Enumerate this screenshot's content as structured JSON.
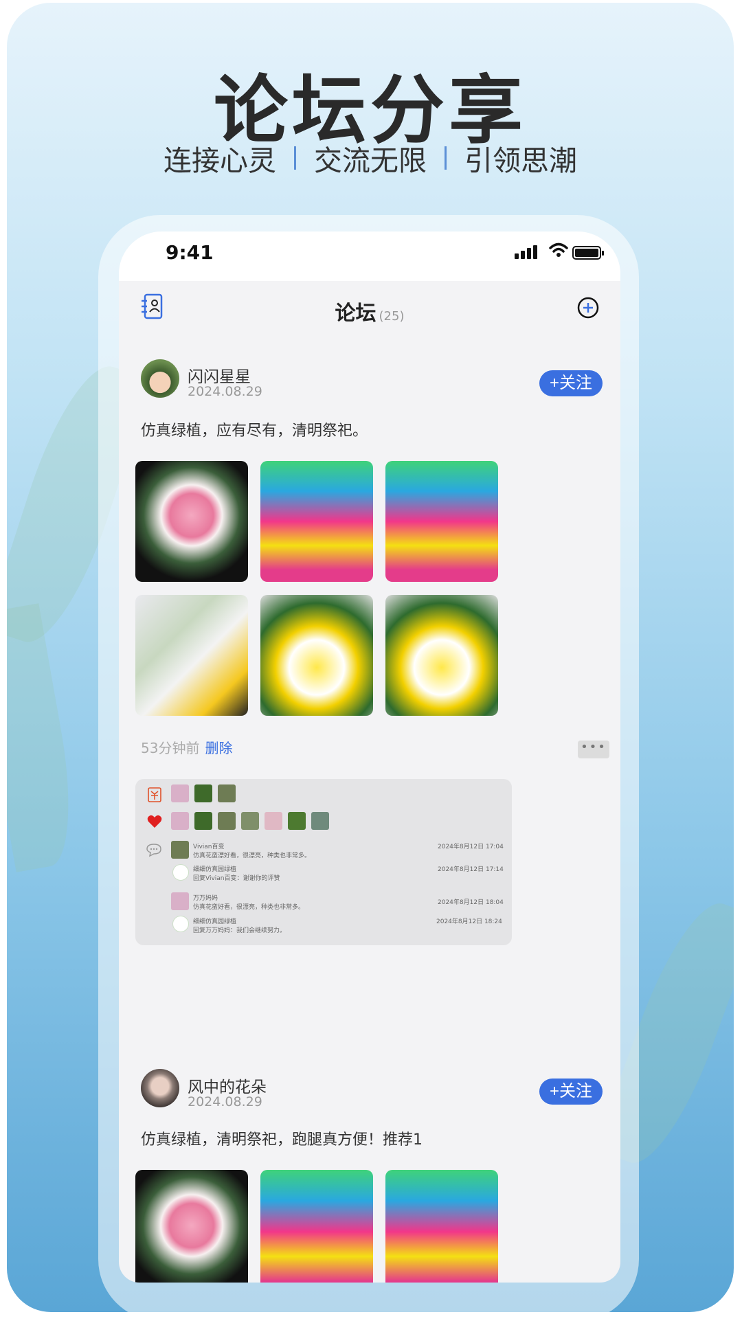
{
  "promo": {
    "headline": "论坛分享",
    "taglines": [
      "连接心灵",
      "交流无限",
      "引领思潮"
    ]
  },
  "status_bar": {
    "time": "9:41"
  },
  "nav": {
    "title": "论坛",
    "count": "(25)"
  },
  "posts": [
    {
      "user": "闪闪星星",
      "date": "2024.08.29",
      "follow": "+关注",
      "text": "仿真绿植，应有尽有，清明祭祀。",
      "time_ago": "53分钟前",
      "delete": "删除",
      "more": "•••",
      "comments": [
        {
          "name": "Vivian百变",
          "text": "仿真花蛮漂好看，很漂亮，种类也非常多。",
          "time": "2024年8月12日 17:04"
        },
        {
          "name": "细细仿真园绿植",
          "text": "回复Vivian百变：谢谢你的评赞",
          "time": "2024年8月12日 17:14"
        },
        {
          "name": "万万妈妈",
          "text": "仿真花蛮好看，很漂亮，种类也非常多。",
          "time": "2024年8月12日 18:04"
        },
        {
          "name": "细细仿真园绿植",
          "text": "回复万万妈妈：我们会继续努力。",
          "time": "2024年8月12日 18:24"
        }
      ]
    },
    {
      "user": "风中的花朵",
      "date": "2024.08.29",
      "follow": "+关注",
      "text": "仿真绿植，清明祭祀，跑腿真方便！推荐1"
    }
  ],
  "icons": {
    "nav_left": "contacts-icon",
    "nav_right": "add-circle-icon",
    "gift": "gift-icon",
    "like": "heart-icon",
    "comment": "comment-icon"
  },
  "colors": {
    "accent": "#3a6fe0",
    "heart": "#e02020",
    "gift": "#e0522a"
  }
}
